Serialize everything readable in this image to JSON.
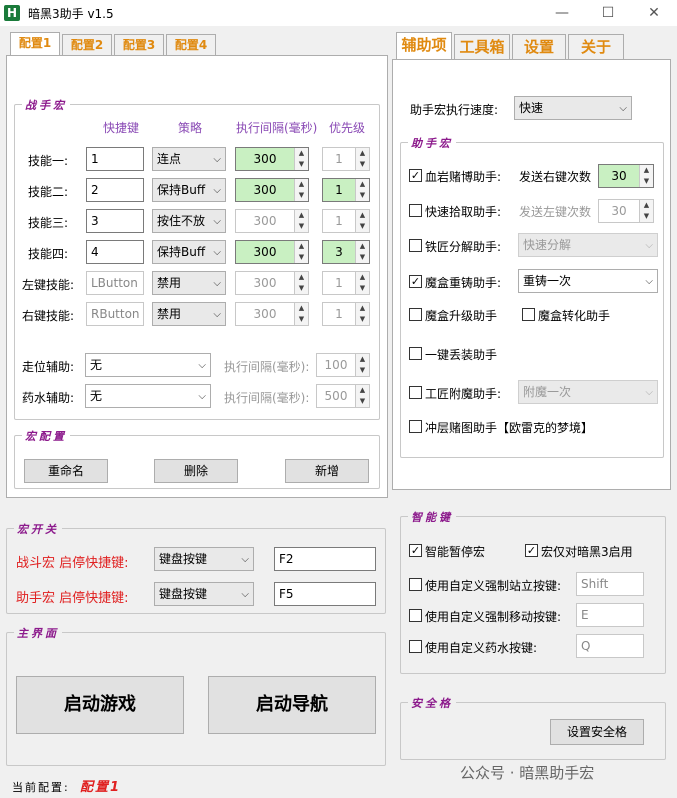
{
  "window": {
    "title": "暗黑3助手 v1.5",
    "icon_letter": "H"
  },
  "tabs_left": [
    "配置1",
    "配置2",
    "配置3",
    "配置4"
  ],
  "tabs_right": [
    "辅助项",
    "工具箱",
    "设置",
    "关于"
  ],
  "battle_macro": {
    "group_label": "战手宏",
    "headers": {
      "hotkey": "快捷键",
      "strategy": "策略",
      "interval": "执行间隔(毫秒)",
      "priority": "优先级"
    },
    "rows": [
      {
        "label": "技能一:",
        "key": "1",
        "strategy": "连点",
        "interval": "300",
        "priority": "1"
      },
      {
        "label": "技能二:",
        "key": "2",
        "strategy": "保持Buff",
        "interval": "300",
        "priority": "1"
      },
      {
        "label": "技能三:",
        "key": "3",
        "strategy": "按住不放",
        "interval": "300",
        "priority": "1"
      },
      {
        "label": "技能四:",
        "key": "4",
        "strategy": "保持Buff",
        "interval": "300",
        "priority": "3"
      },
      {
        "label": "左键技能:",
        "key": "LButton",
        "strategy": "禁用",
        "interval": "300",
        "priority": "1"
      },
      {
        "label": "右键技能:",
        "key": "RButton",
        "strategy": "禁用",
        "interval": "300",
        "priority": "1"
      }
    ],
    "walk_assist": {
      "label": "走位辅助:",
      "value": "无",
      "interval_label": "执行间隔(毫秒):",
      "interval": "100"
    },
    "potion_assist": {
      "label": "药水辅助:",
      "value": "无",
      "interval_label": "执行间隔(毫秒):",
      "interval": "500"
    }
  },
  "macro_config": {
    "group_label": "宏配置",
    "rename": "重命名",
    "delete": "删除",
    "add": "新增"
  },
  "macro_switch": {
    "group_label": "宏开关",
    "battle": {
      "label": "战斗宏 启停快捷键:",
      "type": "键盘按键",
      "key": "F2"
    },
    "helper": {
      "label": "助手宏 启停快捷键:",
      "type": "键盘按键",
      "key": "F5"
    }
  },
  "main_ui": {
    "group_label": "主界面",
    "start_game": "启动游戏",
    "start_nav": "启动导航"
  },
  "status": {
    "label": "当前配置:",
    "value": "配置1"
  },
  "helper": {
    "speed_label": "助手宏执行速度:",
    "speed": "快速",
    "group_label": "助手宏",
    "blood_rock": {
      "label": "血岩赌博助手:",
      "checked": "✓",
      "sub_label": "发送右键次数",
      "count": "30"
    },
    "quick_pick": {
      "label": "快速拾取助手:",
      "checked": "",
      "sub_label": "发送左键次数",
      "count": "30"
    },
    "salvage": {
      "label": "铁匠分解助手:",
      "checked": "",
      "value": "快速分解"
    },
    "reforge": {
      "label": "魔盒重铸助手:",
      "checked": "✓",
      "value": "重铸一次"
    },
    "upgrade": {
      "label": "魔盒升级助手",
      "checked": ""
    },
    "convert": {
      "label": "魔盒转化助手",
      "checked": ""
    },
    "drop_gear": {
      "label": "一键丢装助手",
      "checked": ""
    },
    "enchant": {
      "label": "工匠附魔助手:",
      "checked": "",
      "value": "附魔一次"
    },
    "rift": {
      "label": "冲层赌图助手【欧雷克的梦境】",
      "checked": ""
    }
  },
  "smart_keys": {
    "group_label": "智能键",
    "auto_pause": {
      "label": "智能暂停宏",
      "checked": "✓"
    },
    "d3_only": {
      "label": "宏仅对暗黑3启用",
      "checked": "✓"
    },
    "stand_key": {
      "label": "使用自定义强制站立按键:",
      "checked": "",
      "value": "Shift"
    },
    "move_key": {
      "label": "使用自定义强制移动按键:",
      "checked": "",
      "value": "E"
    },
    "potion_key": {
      "label": "使用自定义药水按键:",
      "checked": "",
      "value": "Q"
    }
  },
  "safe_grid": {
    "group_label": "安全格",
    "button": "设置安全格"
  },
  "watermark": "公众号 · 暗黑助手宏"
}
